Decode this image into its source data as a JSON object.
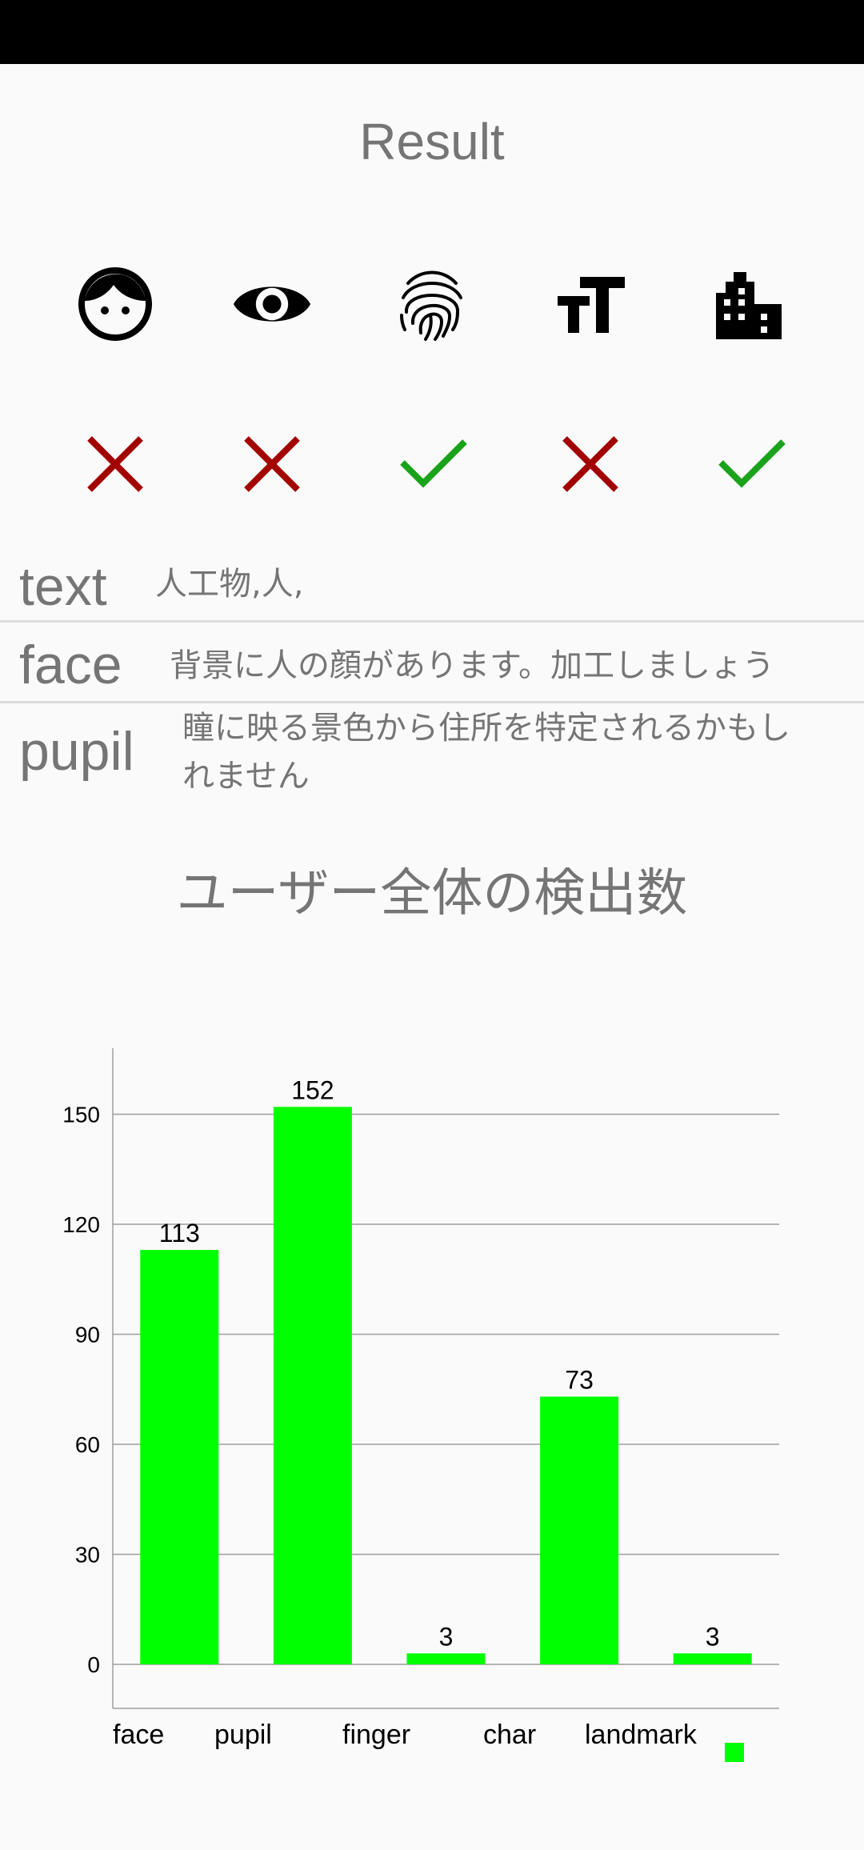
{
  "header": {
    "title": "Result"
  },
  "icons": [
    {
      "name": "face-icon"
    },
    {
      "name": "eye-icon"
    },
    {
      "name": "fingerprint-icon"
    },
    {
      "name": "text-size-icon"
    },
    {
      "name": "building-icon"
    }
  ],
  "statuses": [
    {
      "name": "cross-icon",
      "ok": false,
      "color": "#a30000"
    },
    {
      "name": "cross-icon",
      "ok": false,
      "color": "#a30000"
    },
    {
      "name": "check-icon",
      "ok": true,
      "color": "#1aa31a"
    },
    {
      "name": "cross-icon",
      "ok": false,
      "color": "#a30000"
    },
    {
      "name": "check-icon",
      "ok": true,
      "color": "#1aa31a"
    }
  ],
  "info": {
    "text": {
      "key": "text",
      "value": "人工物,人,"
    },
    "face": {
      "key": "face",
      "value": "背景に人の顔があります。加工しましょう"
    },
    "pupil": {
      "key": "pupil",
      "value": "瞳に映る景色から住所を特定されるかもし",
      "value2": "れません"
    }
  },
  "chart_title": "ユーザー全体の検出数",
  "chart_data": {
    "type": "bar",
    "categories": [
      "face",
      "pupil",
      "finger",
      "char",
      "landmark"
    ],
    "values": [
      113,
      152,
      3,
      73,
      3
    ],
    "ylim": [
      -12,
      168
    ],
    "yticks": [
      0,
      30,
      60,
      90,
      120,
      150
    ],
    "grid": true,
    "bar_color": "#00ff00",
    "legend": "bottom-right"
  }
}
